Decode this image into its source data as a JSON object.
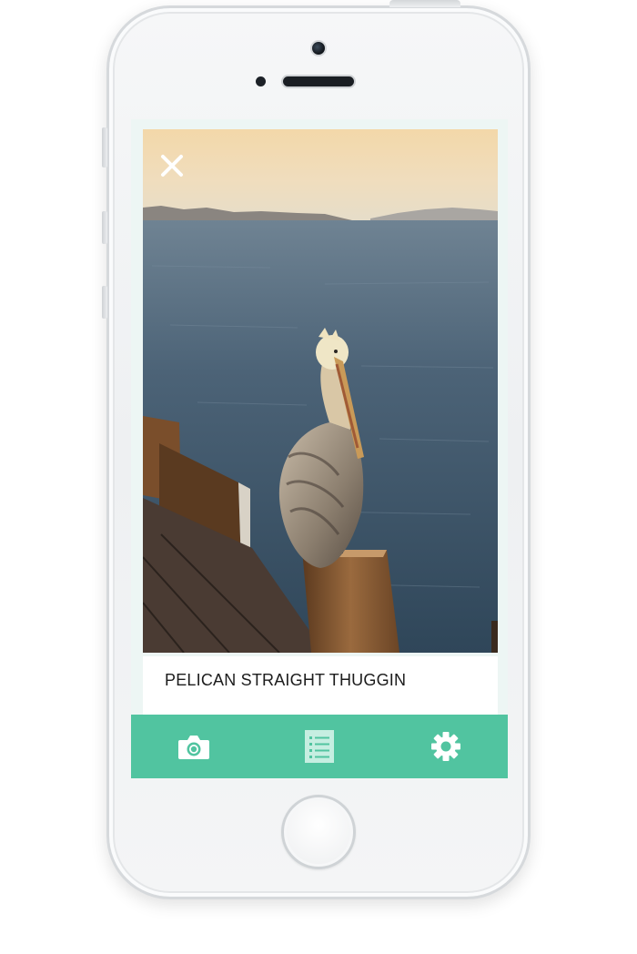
{
  "post": {
    "caption": "PELICAN STRAIGHT THUGGIN"
  },
  "icons": {
    "close": "close-icon",
    "camera": "camera-icon",
    "list": "list-icon",
    "settings": "gear-icon"
  },
  "colors": {
    "accent": "#51c4a0",
    "screen_background": "#edf6f4",
    "caption_text": "#1c1c1c"
  }
}
